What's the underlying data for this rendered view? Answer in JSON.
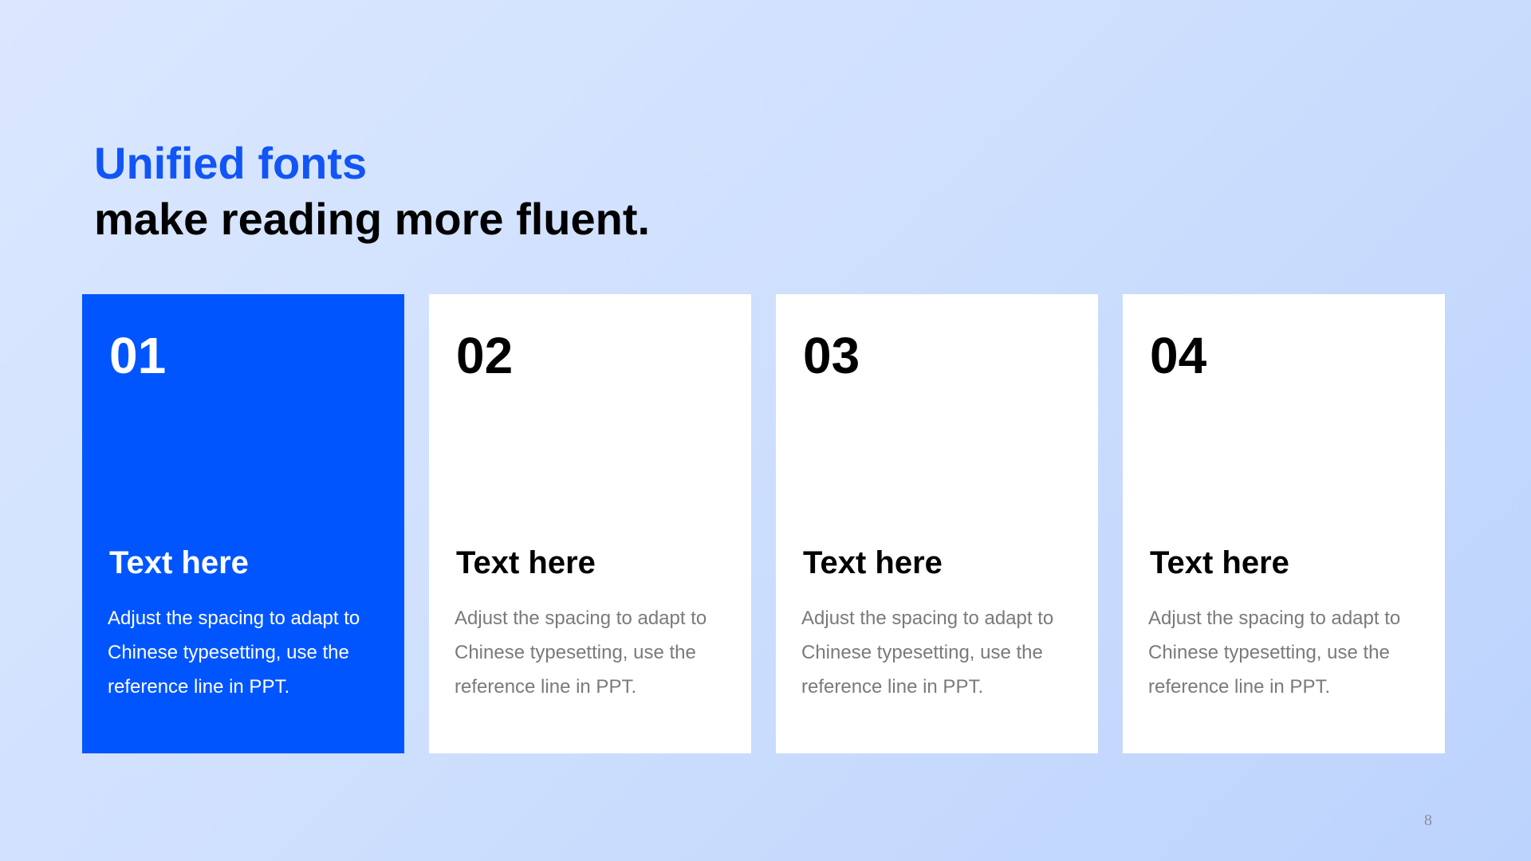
{
  "title": {
    "accent": "Unified fonts",
    "main": "make reading more fluent."
  },
  "cards": [
    {
      "number": "01",
      "heading": "Text here",
      "body": "Adjust the spacing to adapt to Chinese typesetting, use the reference line in PPT."
    },
    {
      "number": "02",
      "heading": "Text here",
      "body": "Adjust the spacing to adapt to Chinese typesetting, use the reference line in PPT."
    },
    {
      "number": "03",
      "heading": "Text here",
      "body": "Adjust the spacing to adapt to Chinese typesetting, use the reference line in PPT."
    },
    {
      "number": "04",
      "heading": "Text here",
      "body": "Adjust the spacing to adapt to Chinese typesetting, use the reference line in PPT."
    }
  ],
  "page_number": "8",
  "colors": {
    "accent": "#1155f5",
    "highlight_card": "#0055ff",
    "card": "#ffffff",
    "body_text": "#7a7a7a"
  }
}
